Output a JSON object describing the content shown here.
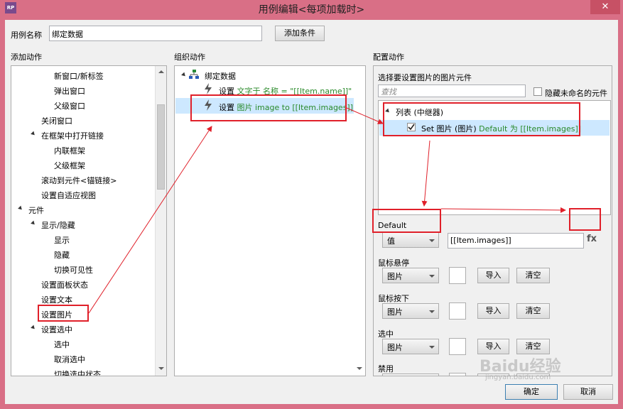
{
  "window": {
    "title": "用例编辑<每项加载时>",
    "app_icon": "RP",
    "close_icon": "close-icon"
  },
  "top": {
    "case_name_label": "用例名称",
    "case_name_value": "绑定数据",
    "add_condition_label": "添加条件"
  },
  "columns": {
    "add_action": "添加动作",
    "organize_action": "组织动作",
    "config_action": "配置动作"
  },
  "add_tree": [
    "新窗口/新标签",
    "弹出窗口",
    "父级窗口",
    "关闭窗口",
    "在框架中打开链接",
    "内联框架",
    "父级框架",
    "滚动到元件<锚链接>",
    "设置自适应视图",
    "元件",
    "显示/隐藏",
    "显示",
    "隐藏",
    "切换可见性",
    "设置面板状态",
    "设置文本",
    "设置图片",
    "设置选中",
    "选中",
    "取消选中",
    "切换选中状态"
  ],
  "organize": {
    "root": "绑定数据",
    "action1": {
      "prefix": "设置",
      "target": "文字于 名称 =",
      "value": "\"[[Item.name]]\""
    },
    "action2": {
      "prefix": "设置",
      "target": "图片 image to",
      "value": "[[Item.images]]"
    }
  },
  "config": {
    "select_label": "选择要设置图片的图片元件",
    "search_placeholder": "查找",
    "hide_unnamed": "隐藏未命名的元件",
    "tree_root": "列表 (中继器)",
    "tree_child_prefix": "Set 图片 (图片)",
    "tree_child_default": "Default 为",
    "tree_child_value": "[[Item.images]]",
    "default_label": "Default",
    "default_select": "值",
    "default_value": "[[Item.images]]",
    "fx_label": "fx",
    "states": [
      {
        "label": "鼠标悬停",
        "select": "图片",
        "import": "导入",
        "clear": "清空"
      },
      {
        "label": "鼠标按下",
        "select": "图片",
        "import": "导入",
        "clear": "清空"
      },
      {
        "label": "选中",
        "select": "图片",
        "import": "导入",
        "clear": "清空"
      },
      {
        "label": "禁用",
        "select": "图片",
        "import": "导入",
        "clear": "清空"
      }
    ]
  },
  "footer": {
    "ok": "确定",
    "cancel": "取消"
  },
  "watermark": {
    "text": "Baidu经验",
    "sub": "jingyan.baidu.com"
  },
  "colors": {
    "titlebar": "#d96f86",
    "highlight": "#e0202a",
    "selection": "#cde8ff",
    "green_text": "#2a8a2a"
  }
}
